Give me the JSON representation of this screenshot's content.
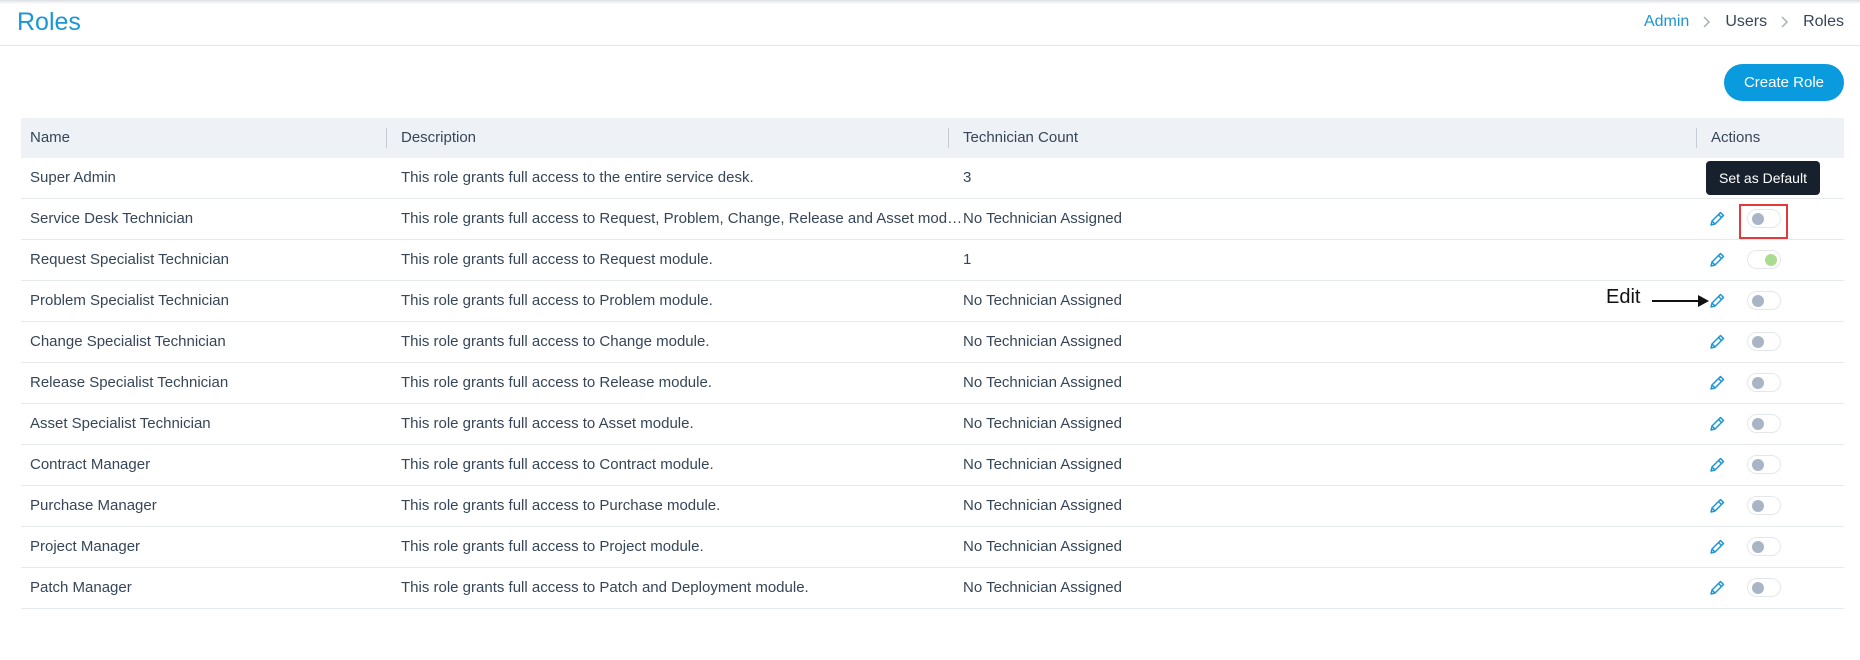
{
  "header": {
    "title": "Roles",
    "breadcrumb": [
      "Admin",
      "Users",
      "Roles"
    ]
  },
  "toolbar": {
    "create_label": "Create Role"
  },
  "table": {
    "columns": [
      "Name",
      "Description",
      "Technician Count",
      "Actions"
    ],
    "rows": [
      {
        "name": "Super Admin",
        "description": "This role grants full access to the entire service desk.",
        "count": "3",
        "has_actions": false
      },
      {
        "name": "Service Desk Technician",
        "description": "This role grants full access to Request, Problem, Change, Release and Asset module.",
        "count": "No Technician Assigned",
        "has_actions": true,
        "default_on": false
      },
      {
        "name": "Request Specialist Technician",
        "description": "This role grants full access to Request module.",
        "count": "1",
        "has_actions": true,
        "default_on": true
      },
      {
        "name": "Problem Specialist Technician",
        "description": "This role grants full access to Problem module.",
        "count": "No Technician Assigned",
        "has_actions": true,
        "default_on": false
      },
      {
        "name": "Change Specialist Technician",
        "description": "This role grants full access to Change module.",
        "count": "No Technician Assigned",
        "has_actions": true,
        "default_on": false
      },
      {
        "name": "Release Specialist Technician",
        "description": "This role grants full access to Release module.",
        "count": "No Technician Assigned",
        "has_actions": true,
        "default_on": false
      },
      {
        "name": "Asset Specialist Technician",
        "description": "This role grants full access to Asset module.",
        "count": "No Technician Assigned",
        "has_actions": true,
        "default_on": false
      },
      {
        "name": "Contract Manager",
        "description": "This role grants full access to Contract module.",
        "count": "No Technician Assigned",
        "has_actions": true,
        "default_on": false
      },
      {
        "name": "Purchase Manager",
        "description": "This role grants full access to Purchase module.",
        "count": "No Technician Assigned",
        "has_actions": true,
        "default_on": false
      },
      {
        "name": "Project Manager",
        "description": "This role grants full access to Project module.",
        "count": "No Technician Assigned",
        "has_actions": true,
        "default_on": false
      },
      {
        "name": "Patch Manager",
        "description": "This role grants full access to Patch and Deployment module.",
        "count": "No Technician Assigned",
        "has_actions": true,
        "default_on": false
      }
    ]
  },
  "tooltip": {
    "text": "Set as Default"
  },
  "annotation": {
    "label": "Edit"
  },
  "icons": {
    "edit": "pencil-icon",
    "breadcrumb_separator": "chevron-right-icon",
    "arrow": "arrow-right-icon"
  },
  "colors": {
    "accent": "#1b97d5",
    "button": "#099bde",
    "toggle_on": "#a9dc8e",
    "toggle_off": "#a9b5c6",
    "highlight": "#e23b3b",
    "tooltip_bg": "#17212d"
  }
}
